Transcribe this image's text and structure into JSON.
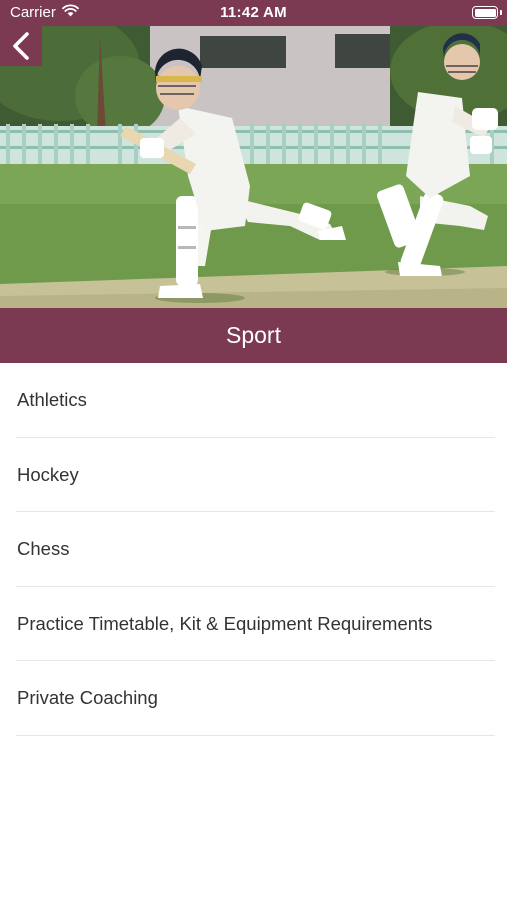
{
  "status_bar": {
    "carrier": "Carrier",
    "time": "11:42 AM",
    "wifi_icon": "wifi-icon",
    "battery_icon": "battery-icon"
  },
  "header": {
    "back_icon": "chevron-left-icon",
    "title": "Sport"
  },
  "menu": {
    "items": [
      {
        "label": "Athletics"
      },
      {
        "label": "Hockey"
      },
      {
        "label": "Chess"
      },
      {
        "label": "Practice Timetable, Kit & Equipment Requirements"
      },
      {
        "label": "Private Coaching"
      }
    ]
  },
  "colors": {
    "brand": "#7b3a52",
    "text": "#333333",
    "divider": "#e6e6e6",
    "background": "#ffffff"
  }
}
